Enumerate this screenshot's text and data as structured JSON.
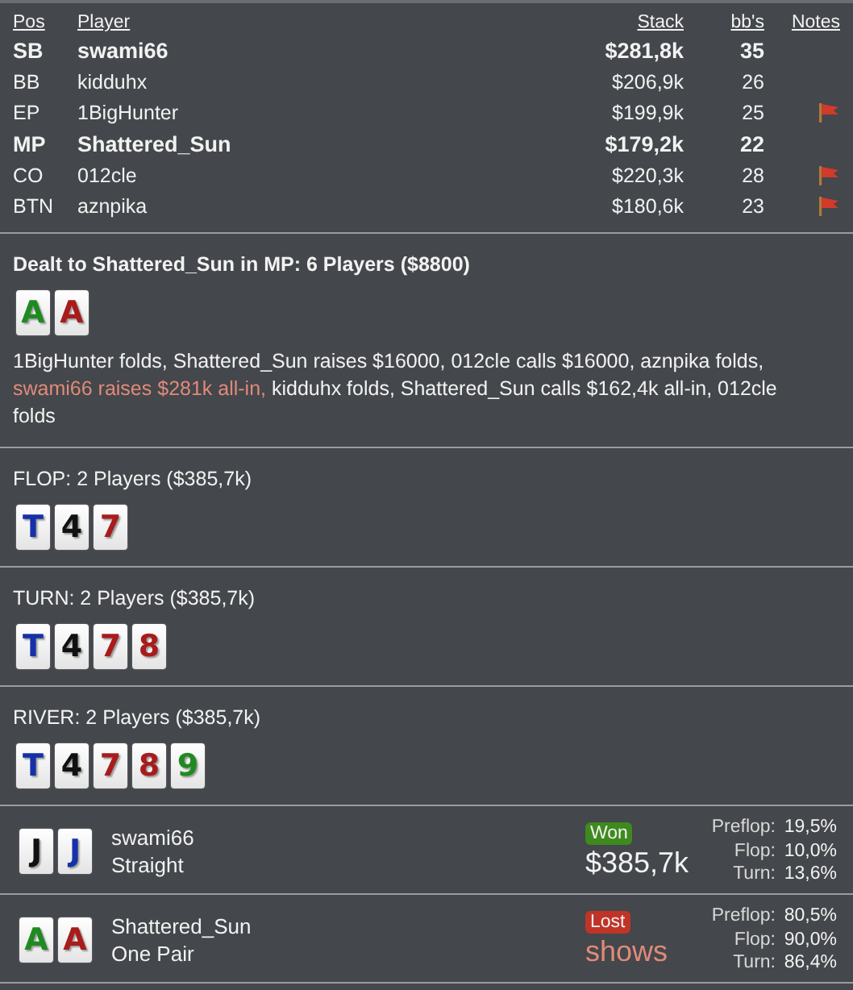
{
  "players_table": {
    "columns": [
      "Pos",
      "Player",
      "Stack",
      "bb's",
      "Notes"
    ],
    "rows": [
      {
        "pos": "SB",
        "player": "swami66",
        "stack": "$281,8k",
        "bbs": "35",
        "highlighted": true,
        "note": false
      },
      {
        "pos": "BB",
        "player": "kidduhx",
        "stack": "$206,9k",
        "bbs": "26",
        "highlighted": false,
        "note": false
      },
      {
        "pos": "EP",
        "player": "1BigHunter",
        "stack": "$199,9k",
        "bbs": "25",
        "highlighted": false,
        "note": true
      },
      {
        "pos": "MP",
        "player": "Shattered_Sun",
        "stack": "$179,2k",
        "bbs": "22",
        "highlighted": true,
        "note": false
      },
      {
        "pos": "CO",
        "player": "012cle",
        "stack": "$220,3k",
        "bbs": "28",
        "highlighted": false,
        "note": true
      },
      {
        "pos": "BTN",
        "player": "aznpika",
        "stack": "$180,6k",
        "bbs": "23",
        "highlighted": false,
        "note": true
      }
    ]
  },
  "streets": [
    {
      "title": "Dealt to Shattered_Sun in MP: 6 Players ($8800)",
      "bold": true,
      "cards": [
        {
          "rank": "A",
          "color": "#1f8a1f"
        },
        {
          "rank": "A",
          "color": "#a81c1c"
        }
      ],
      "actions": [
        {
          "text": "1BigHunter folds, Shattered_Sun raises $16000, 012cle calls $16000, aznpika folds, ",
          "highlight": false
        },
        {
          "text": "swami66 raises $281k all-in,",
          "highlight": true
        },
        {
          "text": " kidduhx folds, Shattered_Sun calls $162,4k all-in, 012cle folds",
          "highlight": false
        }
      ]
    },
    {
      "title": "FLOP: 2 Players ($385,7k)",
      "bold": false,
      "cards": [
        {
          "rank": "T",
          "color": "#1530a8"
        },
        {
          "rank": "4",
          "color": "#111111"
        },
        {
          "rank": "7",
          "color": "#a81c1c"
        }
      ]
    },
    {
      "title": "TURN: 2 Players ($385,7k)",
      "bold": false,
      "cards": [
        {
          "rank": "T",
          "color": "#1530a8"
        },
        {
          "rank": "4",
          "color": "#111111"
        },
        {
          "rank": "7",
          "color": "#a81c1c"
        },
        {
          "rank": "8",
          "color": "#a81c1c"
        }
      ]
    },
    {
      "title": "RIVER: 2 Players ($385,7k)",
      "bold": false,
      "cards": [
        {
          "rank": "T",
          "color": "#1530a8"
        },
        {
          "rank": "4",
          "color": "#111111"
        },
        {
          "rank": "7",
          "color": "#a81c1c"
        },
        {
          "rank": "8",
          "color": "#a81c1c"
        },
        {
          "rank": "9",
          "color": "#1f8a1f"
        }
      ]
    }
  ],
  "results": [
    {
      "cards": [
        {
          "rank": "J",
          "color": "#111111"
        },
        {
          "rank": "J",
          "color": "#1530a8"
        }
      ],
      "player": "swami66",
      "hand": "Straight",
      "kind": "won",
      "badge": "Won",
      "amount": "$385,7k",
      "equity": [
        {
          "label": "Preflop:",
          "value": "19,5%"
        },
        {
          "label": "Flop:",
          "value": "10,0%"
        },
        {
          "label": "Turn:",
          "value": "13,6%"
        }
      ]
    },
    {
      "cards": [
        {
          "rank": "A",
          "color": "#1f8a1f"
        },
        {
          "rank": "A",
          "color": "#a81c1c"
        }
      ],
      "player": "Shattered_Sun",
      "hand": "One Pair",
      "kind": "lost",
      "badge": "Lost",
      "amount": "shows",
      "equity": [
        {
          "label": "Preflop:",
          "value": "80,5%"
        },
        {
          "label": "Flop:",
          "value": "90,0%"
        },
        {
          "label": "Turn:",
          "value": "86,4%"
        }
      ]
    }
  ]
}
